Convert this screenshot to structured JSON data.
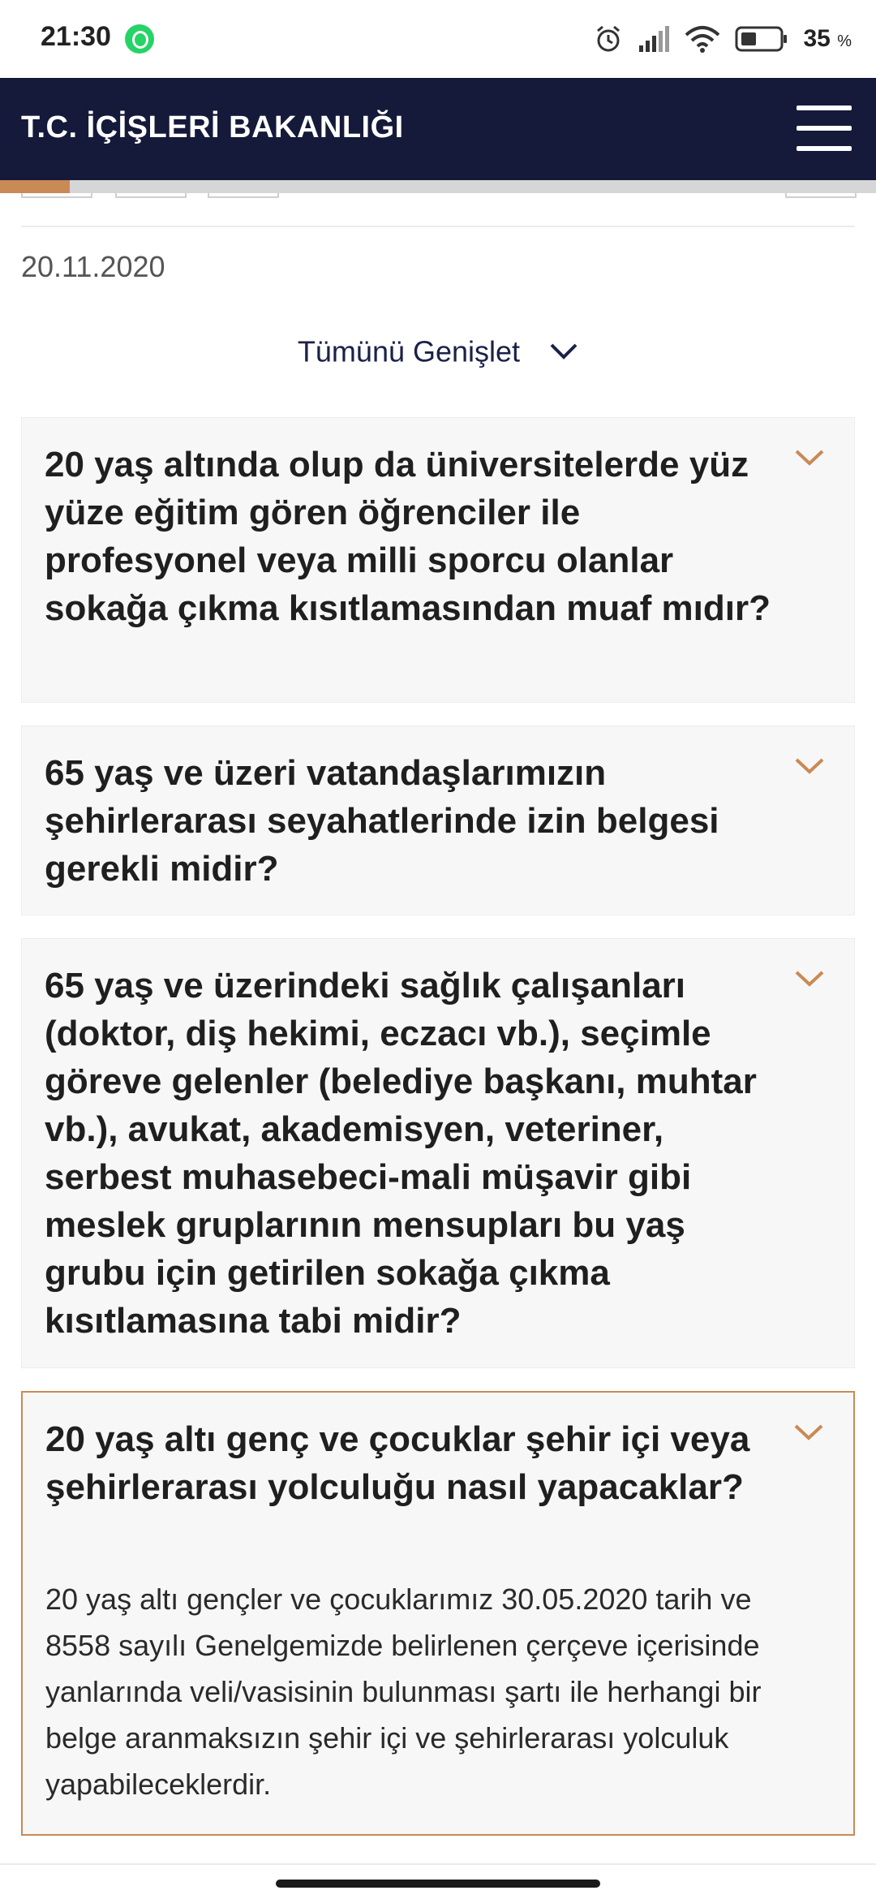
{
  "status_bar": {
    "time": "21:30",
    "battery_percent": "35",
    "battery_unit": "%",
    "icons": [
      "whatsapp-icon",
      "alarm-icon",
      "signal-icon",
      "wifi-icon",
      "battery-icon"
    ]
  },
  "header": {
    "title": "T.C. İÇİŞLERİ BAKANLIĞI",
    "menu_icon": "hamburger-menu-icon"
  },
  "reading_progress": 0.08,
  "page": {
    "date": "20.11.2020",
    "expand_all_label": "Tümünü Genişlet"
  },
  "faq": [
    {
      "question": "20 yaş altında olup da üniversitelerde yüz yüze eğitim gören öğrenciler ile profesyonel veya milli sporcu olanlar sokağa çıkma kısıtlamasından muaf mıdır?",
      "expanded": false
    },
    {
      "question": "65 yaş ve üzeri vatandaşlarımızın şehirlerarası seyahatlerinde izin belgesi gerekli midir?",
      "expanded": false
    },
    {
      "question": "65 yaş ve üzerindeki sağlık çalışanları (doktor, diş hekimi, eczacı vb.), seçimle göreve gelenler (belediye başkanı, muhtar vb.), avukat, akademisyen, veteriner, serbest muhasebeci-mali müşavir gibi meslek gruplarının mensupları bu yaş grubu için getirilen sokağa çıkma kısıtlamasına tabi midir?",
      "expanded": false
    },
    {
      "question": "20 yaş altı genç ve çocuklar şehir içi veya şehirlerarası yolculuğu nasıl yapacaklar?",
      "answer": "20 yaş altı gençler ve çocuklarımız 30.05.2020 tarih ve 8558 sayılı Genelgemizde belirlenen çerçeve içerisinde yanlarında veli/vasisinin bulunması şartı ile herhangi bir belge aranmaksızın şehir içi ve şehirlerarası yolculuk yapabileceklerdir.",
      "expanded": true
    }
  ],
  "colors": {
    "header_bg": "#151a3a",
    "accent": "#c98a55",
    "card_bg": "#f7f7f7"
  }
}
